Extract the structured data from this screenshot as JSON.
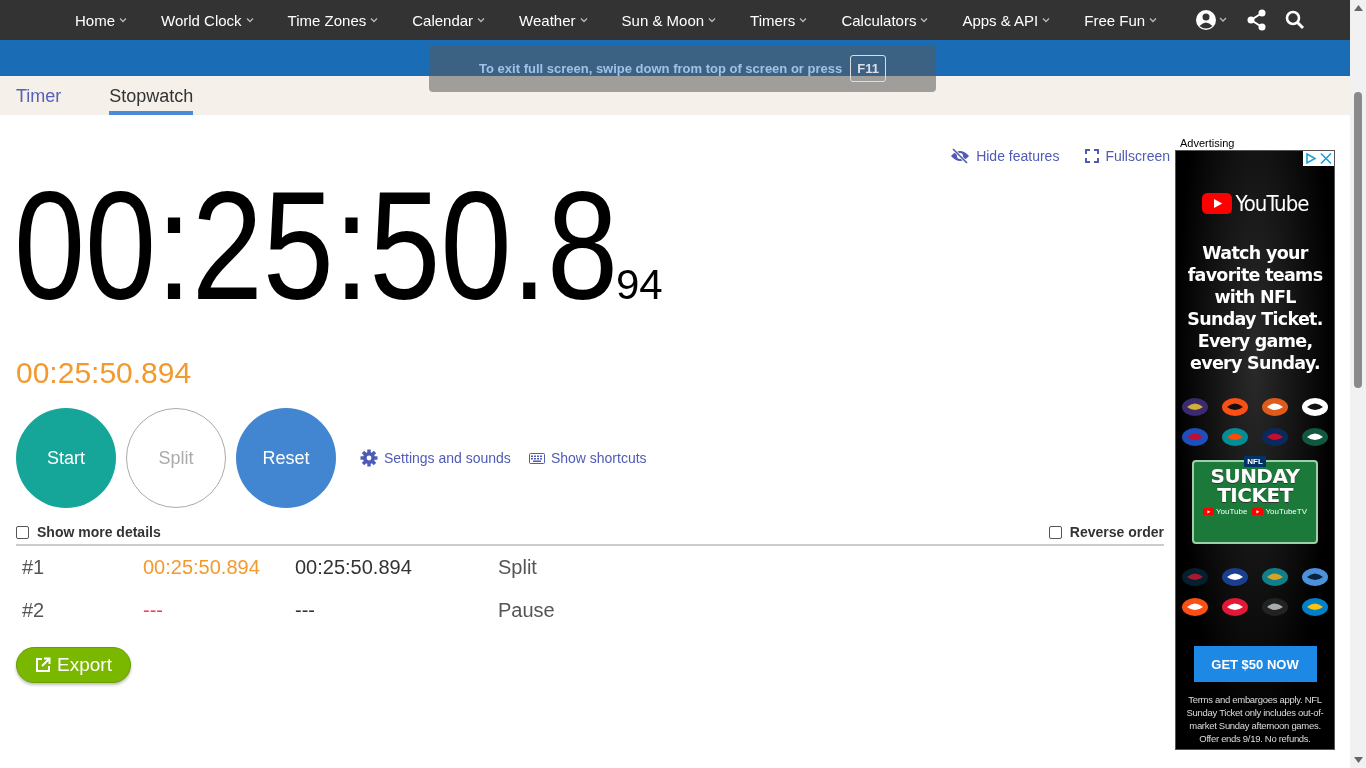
{
  "nav": {
    "items": [
      {
        "label": "Home"
      },
      {
        "label": "World Clock"
      },
      {
        "label": "Time Zones"
      },
      {
        "label": "Calendar"
      },
      {
        "label": "Weather"
      },
      {
        "label": "Sun & Moon"
      },
      {
        "label": "Timers"
      },
      {
        "label": "Calculators"
      },
      {
        "label": "Apps & API"
      },
      {
        "label": "Free Fun"
      }
    ]
  },
  "fullscreen_notice": {
    "text": "To exit full screen, swipe down from top of screen or press",
    "key": "F11"
  },
  "tabs": [
    {
      "label": "Timer",
      "selected": false
    },
    {
      "label": "Stopwatch",
      "selected": true
    }
  ],
  "tools": [
    {
      "kind": "hide",
      "label": "Hide features"
    },
    {
      "kind": "fullscreen",
      "label": "Fullscreen"
    }
  ],
  "display": {
    "main": "00:25:50.8",
    "fraction": "94",
    "total": "00:25:50.894"
  },
  "buttons": [
    {
      "kind": "start",
      "label": "Start"
    },
    {
      "kind": "split",
      "label": "Split"
    },
    {
      "kind": "reset",
      "label": "Reset"
    }
  ],
  "links": [
    {
      "kind": "settings",
      "label": "Settings and sounds"
    },
    {
      "kind": "shortcuts",
      "label": "Show shortcuts"
    }
  ],
  "options": [
    {
      "label": "Show more details",
      "checked": false
    },
    {
      "label": "Reverse order",
      "checked": false
    }
  ],
  "laps": [
    {
      "kind": "split",
      "number": "#1",
      "lap": "00:25:50.894",
      "total": "00:25:50.894",
      "type": "Split"
    },
    {
      "kind": "pause",
      "number": "#2",
      "lap": "---",
      "total": "---",
      "type": "Pause"
    }
  ],
  "export": {
    "label": "Export"
  },
  "ad": {
    "label": "Advertising",
    "brand": "YouTube",
    "headline": "Watch your favorite teams with NFL Sunday Ticket. Every game, every Sunday.",
    "ticket": {
      "badge": "NFL",
      "line_1": "SUNDAY",
      "line_2": "TICKET",
      "partner_1": "YouTube",
      "partner_2": "YouTubeTV"
    },
    "cta": "GET $50 NOW",
    "terms": "Terms and embargoes apply. NFL Sunday Ticket only includes out-of-market Sunday afternoon games. Offer ends 9/19. No refunds."
  }
}
